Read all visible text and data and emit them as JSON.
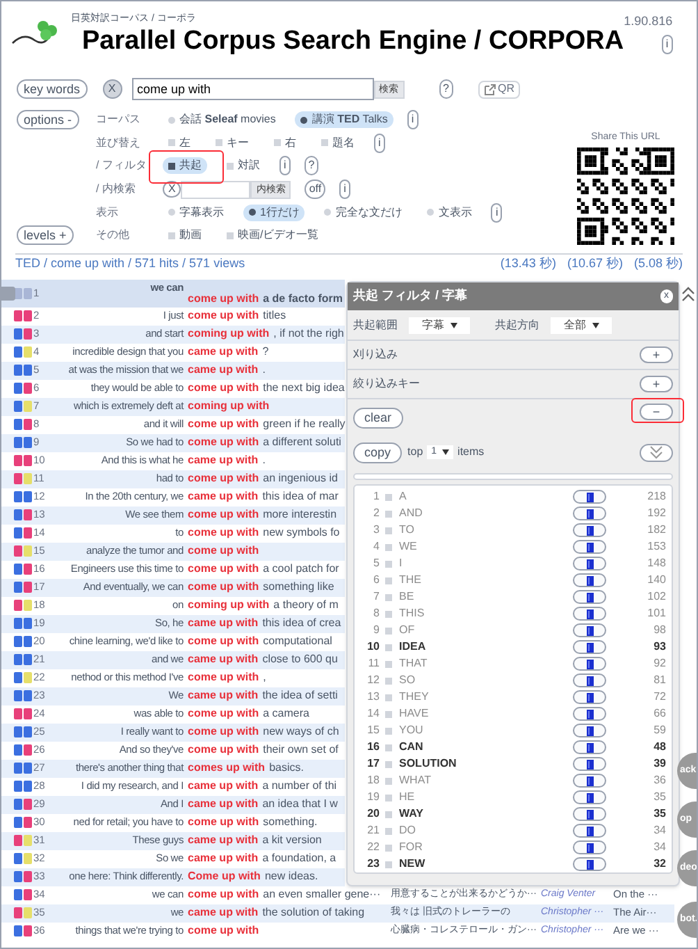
{
  "header": {
    "subtitle": "日英対訳コーパス / コーポラ",
    "title": "Parallel Corpus Search Engine / CORPORA",
    "version": "1.90.816",
    "info": "i"
  },
  "search": {
    "toggle": "key words",
    "clear": "X",
    "query": "come up with",
    "submit": "検索",
    "help": "?",
    "qr": "QR"
  },
  "options": {
    "toggle": "options -",
    "levels": "levels +",
    "share_label": "Share This URL",
    "rows": [
      {
        "label": "コーパス",
        "items": [
          {
            "kind": "radio",
            "label": "会話 **Seleaf** movies",
            "selected": false
          },
          {
            "kind": "radio",
            "label": "講演 **TED** Talks",
            "selected": true
          },
          {
            "kind": "info",
            "label": "i"
          }
        ]
      },
      {
        "label": "並び替え",
        "items": [
          {
            "kind": "checkbox",
            "label": "左",
            "checked": false
          },
          {
            "kind": "checkbox",
            "label": "キー",
            "checked": false
          },
          {
            "kind": "checkbox",
            "label": "右",
            "checked": false
          },
          {
            "kind": "checkbox",
            "label": "題名",
            "checked": false
          },
          {
            "kind": "info",
            "label": "i"
          }
        ]
      },
      {
        "label": "/ フィルタ",
        "items": [
          {
            "kind": "checkbox",
            "label": "共起",
            "checked": true,
            "highlighted": true
          },
          {
            "kind": "checkbox",
            "label": "対訳",
            "checked": false,
            "highlighted": false
          },
          {
            "kind": "info",
            "label": "i"
          },
          {
            "kind": "info",
            "label": "?"
          }
        ]
      },
      {
        "label": "/ 内検索",
        "items": [
          {
            "kind": "clear",
            "label": "X"
          },
          {
            "kind": "input"
          },
          {
            "kind": "button",
            "label": "内検索"
          },
          {
            "kind": "info",
            "label": "off"
          },
          {
            "kind": "info",
            "label": "i"
          }
        ]
      },
      {
        "label": "表示",
        "items": [
          {
            "kind": "radio",
            "label": "字幕表示",
            "selected": false
          },
          {
            "kind": "radio",
            "label": "1行だけ",
            "selected": true
          },
          {
            "kind": "radio",
            "label": "完全な文だけ",
            "selected": false
          },
          {
            "kind": "radio",
            "label": "文表示",
            "selected": false
          },
          {
            "kind": "info",
            "label": "i"
          }
        ]
      },
      {
        "label": "その他",
        "items": [
          {
            "kind": "checkbox",
            "label": "動画",
            "checked": false
          },
          {
            "kind": "checkbox",
            "label": "映画/ビデオ一覧",
            "checked": false
          }
        ]
      }
    ]
  },
  "results": {
    "breadcrumb": "TED / come up with / 571 hits / 571 views",
    "timings": [
      "(13.43 秒)",
      "(10.67 秒)",
      "(5.08 秒)"
    ],
    "rows": [
      {
        "number": "1",
        "selected": true,
        "badges": [
          {
            "color": "#a9b6d6"
          },
          {
            "color": "#a9b6d6"
          }
        ],
        "before": "we can",
        "match": "come up with",
        "after": "a de facto form"
      },
      {
        "number": "2",
        "selected": false,
        "badges": [
          {
            "color": "#e8407a"
          },
          {
            "color": "#e8407a"
          }
        ],
        "before": "I just",
        "match": "come up with",
        "after": "titles"
      },
      {
        "number": "3",
        "selected": false,
        "badges": [
          {
            "color": "#3b6fe0"
          },
          {
            "color": "#e8407a"
          }
        ],
        "before": "and start",
        "match": "coming up with",
        "after": ", if not the righ"
      },
      {
        "number": "4",
        "selected": false,
        "badges": [
          {
            "color": "#3b6fe0"
          },
          {
            "color": "#e6df6a"
          }
        ],
        "before": "incredible design that you",
        "match": "came up with",
        "after": "?"
      },
      {
        "number": "5",
        "selected": false,
        "badges": [
          {
            "color": "#3b6fe0"
          },
          {
            "color": "#3b6fe0"
          }
        ],
        "before": "at was the mission that we",
        "match": "came up with",
        "after": "."
      },
      {
        "number": "6",
        "selected": false,
        "badges": [
          {
            "color": "#3b6fe0"
          },
          {
            "color": "#e8407a"
          }
        ],
        "before": "they would be able to",
        "match": "come up with",
        "after": "the next big idea"
      },
      {
        "number": "7",
        "selected": false,
        "badges": [
          {
            "color": "#3b6fe0"
          },
          {
            "color": "#e6df6a"
          }
        ],
        "before": "which is extremely deft at",
        "match": "coming up with"
      },
      {
        "number": "8",
        "selected": false,
        "badges": [
          {
            "color": "#3b6fe0"
          },
          {
            "color": "#e8407a"
          }
        ],
        "before": "and it will",
        "match": "come up with",
        "after": "green if he really"
      },
      {
        "number": "9",
        "selected": false,
        "badges": [
          {
            "color": "#3b6fe0"
          },
          {
            "color": "#3b6fe0"
          }
        ],
        "before": "So we had to",
        "match": "come up with",
        "after": "a different soluti"
      },
      {
        "number": "10",
        "selected": false,
        "badges": [
          {
            "color": "#e8407a"
          },
          {
            "color": "#e8407a"
          }
        ],
        "before": "And this is what he",
        "match": "came up with",
        "after": "."
      },
      {
        "number": "11",
        "selected": false,
        "badges": [
          {
            "color": "#e8407a"
          },
          {
            "color": "#e6df6a"
          }
        ],
        "before": "had to",
        "match": "come up with",
        "after": "an ingenious id"
      },
      {
        "number": "12",
        "selected": false,
        "badges": [
          {
            "color": "#3b6fe0"
          },
          {
            "color": "#3b6fe0"
          }
        ],
        "before": "In the 20th century, we",
        "match": "came up with",
        "after": "this idea of mar"
      },
      {
        "number": "13",
        "selected": false,
        "badges": [
          {
            "color": "#3b6fe0"
          },
          {
            "color": "#e8407a"
          }
        ],
        "before": "We see them",
        "match": "come up with",
        "after": "more interestin"
      },
      {
        "number": "14",
        "selected": false,
        "badges": [
          {
            "color": "#3b6fe0"
          },
          {
            "color": "#e8407a"
          }
        ],
        "before": "to",
        "match": "come up with",
        "after": "new symbols fo"
      },
      {
        "number": "15",
        "selected": false,
        "badges": [
          {
            "color": "#e8407a"
          },
          {
            "color": "#e6df6a"
          }
        ],
        "before": "analyze the tumor and",
        "match": "come up with"
      },
      {
        "number": "16",
        "selected": false,
        "badges": [
          {
            "color": "#3b6fe0"
          },
          {
            "color": "#e8407a"
          }
        ],
        "before": "Engineers use this time to",
        "match": "come up with",
        "after": "a cool patch for"
      },
      {
        "number": "17",
        "selected": false,
        "badges": [
          {
            "color": "#3b6fe0"
          },
          {
            "color": "#e8407a"
          }
        ],
        "before": "And eventually, we can",
        "match": "come up with",
        "after": "something like"
      },
      {
        "number": "18",
        "selected": false,
        "badges": [
          {
            "color": "#e8407a"
          },
          {
            "color": "#e6df6a"
          }
        ],
        "before": "on",
        "match": "coming up with",
        "after": "a theory of m"
      },
      {
        "number": "19",
        "selected": false,
        "badges": [
          {
            "color": "#3b6fe0"
          },
          {
            "color": "#3b6fe0"
          }
        ],
        "before": "So, he",
        "match": "came up with",
        "after": "this idea of crea"
      },
      {
        "number": "20",
        "selected": false,
        "badges": [
          {
            "color": "#3b6fe0"
          },
          {
            "color": "#3b6fe0"
          }
        ],
        "before": "chine learning, we'd like to",
        "match": "come up with",
        "after": "computational"
      },
      {
        "number": "21",
        "selected": false,
        "badges": [
          {
            "color": "#3b6fe0"
          },
          {
            "color": "#3b6fe0"
          }
        ],
        "before": "and we",
        "match": "came up with",
        "after": "close to 600 qu"
      },
      {
        "number": "22",
        "selected": false,
        "badges": [
          {
            "color": "#3b6fe0"
          },
          {
            "color": "#e6df6a"
          }
        ],
        "before": "nethod or this method I've",
        "match": "come up with",
        "after": ","
      },
      {
        "number": "23",
        "selected": false,
        "badges": [
          {
            "color": "#3b6fe0"
          },
          {
            "color": "#3b6fe0"
          }
        ],
        "before": "We",
        "match": "came up with",
        "after": "the idea of setti"
      },
      {
        "number": "24",
        "selected": false,
        "badges": [
          {
            "color": "#e8407a"
          },
          {
            "color": "#e8407a"
          }
        ],
        "before": "was able to",
        "match": "come up with",
        "after": "a camera"
      },
      {
        "number": "25",
        "selected": false,
        "badges": [
          {
            "color": "#3b6fe0"
          },
          {
            "color": "#3b6fe0"
          }
        ],
        "before": "I really want to",
        "match": "come up with",
        "after": "new ways of ch"
      },
      {
        "number": "26",
        "selected": false,
        "badges": [
          {
            "color": "#3b6fe0"
          },
          {
            "color": "#e8407a"
          }
        ],
        "before": "And so they've",
        "match": "come up with",
        "after": "their own set of"
      },
      {
        "number": "27",
        "selected": false,
        "badges": [
          {
            "color": "#3b6fe0"
          },
          {
            "color": "#3b6fe0"
          }
        ],
        "before": "there's another thing that",
        "match": "comes up with",
        "after": "basics."
      },
      {
        "number": "28",
        "selected": false,
        "badges": [
          {
            "color": "#3b6fe0"
          },
          {
            "color": "#3b6fe0"
          }
        ],
        "before": "I did my research, and I",
        "match": "came up with",
        "after": "a number of thi"
      },
      {
        "number": "29",
        "selected": false,
        "badges": [
          {
            "color": "#3b6fe0"
          },
          {
            "color": "#e8407a"
          }
        ],
        "before": "And I",
        "match": "came up with",
        "after": "an idea that I w"
      },
      {
        "number": "30",
        "selected": false,
        "badges": [
          {
            "color": "#3b6fe0"
          },
          {
            "color": "#e8407a"
          }
        ],
        "before": "ned for retail; you have to",
        "match": "come up with",
        "after": "something."
      },
      {
        "number": "31",
        "selected": false,
        "badges": [
          {
            "color": "#e8407a"
          },
          {
            "color": "#e6df6a"
          }
        ],
        "before": "These guys",
        "match": "came up with",
        "after": "a kit version"
      },
      {
        "number": "32",
        "selected": false,
        "badges": [
          {
            "color": "#3b6fe0"
          },
          {
            "color": "#e6df6a"
          }
        ],
        "before": "So we",
        "match": "came up with",
        "after": "a foundation, a"
      },
      {
        "number": "33",
        "selected": false,
        "badges": [
          {
            "color": "#3b6fe0"
          },
          {
            "color": "#e8407a"
          }
        ],
        "before": "one here: Think differently.",
        "match": "Come up with",
        "after": "new ideas."
      },
      {
        "number": "34",
        "selected": false,
        "badges": [
          {
            "color": "#3b6fe0"
          },
          {
            "color": "#e8407a"
          }
        ],
        "before": "we can",
        "match": "come up with",
        "after": "an even smaller gene···",
        "translation": "用意することが出来るかどうか···",
        "speaker": "Craig Venter",
        "talk": "On the ···"
      },
      {
        "number": "35",
        "selected": false,
        "badges": [
          {
            "color": "#e8407a"
          },
          {
            "color": "#e6df6a"
          }
        ],
        "before": "we",
        "match": "came up with",
        "after": "the solution of taking",
        "translation": "我々は 旧式のトレーラーの",
        "speaker": "Christopher ···",
        "talk": "The Air···"
      },
      {
        "number": "36",
        "selected": false,
        "badges": [
          {
            "color": "#3b6fe0"
          },
          {
            "color": "#e8407a"
          }
        ],
        "before": "things that we're trying to",
        "match": "come up with",
        "translation": "心臓病・コレステロール・ガン···",
        "speaker": "Christopher ···",
        "talk": "Are we ···"
      }
    ]
  },
  "filter_panel": {
    "title": "共起 フィルタ / 字幕",
    "close": "x",
    "range_label": "共起範囲",
    "range_value": "字幕",
    "direction_label": "共起方向",
    "direction_value": "全部",
    "sections": [
      {
        "label": "刈り込み",
        "button": "+"
      },
      {
        "label": "絞り込みキー",
        "button": "+"
      }
    ],
    "clear": "clear",
    "collapse": {
      "label": "−",
      "highlighted": true
    },
    "copy": "copy",
    "top_label": "top",
    "top_value": "1",
    "items_label": "items",
    "words": [
      {
        "rank": "1",
        "word": "A",
        "count": "218",
        "active": false
      },
      {
        "rank": "2",
        "word": "AND",
        "count": "192",
        "active": false
      },
      {
        "rank": "3",
        "word": "TO",
        "count": "182",
        "active": false
      },
      {
        "rank": "4",
        "word": "WE",
        "count": "153",
        "active": false
      },
      {
        "rank": "5",
        "word": "I",
        "count": "148",
        "active": false
      },
      {
        "rank": "6",
        "word": "THE",
        "count": "140",
        "active": false
      },
      {
        "rank": "7",
        "word": "BE",
        "count": "102",
        "active": false
      },
      {
        "rank": "8",
        "word": "THIS",
        "count": "101",
        "active": false
      },
      {
        "rank": "9",
        "word": "OF",
        "count": "98",
        "active": false
      },
      {
        "rank": "10",
        "word": "IDEA",
        "count": "93",
        "active": true
      },
      {
        "rank": "11",
        "word": "THAT",
        "count": "92",
        "active": false
      },
      {
        "rank": "12",
        "word": "SO",
        "count": "81",
        "active": false
      },
      {
        "rank": "13",
        "word": "THEY",
        "count": "72",
        "active": false
      },
      {
        "rank": "14",
        "word": "HAVE",
        "count": "66",
        "active": false
      },
      {
        "rank": "15",
        "word": "YOU",
        "count": "59",
        "active": false
      },
      {
        "rank": "16",
        "word": "CAN",
        "count": "48",
        "active": true
      },
      {
        "rank": "17",
        "word": "SOLUTION",
        "count": "39",
        "active": true
      },
      {
        "rank": "18",
        "word": "WHAT",
        "count": "36",
        "active": false
      },
      {
        "rank": "19",
        "word": "HE",
        "count": "35",
        "active": false
      },
      {
        "rank": "20",
        "word": "WAY",
        "count": "35",
        "active": true
      },
      {
        "rank": "21",
        "word": "DO",
        "count": "34",
        "active": false
      },
      {
        "rank": "22",
        "word": "FOR",
        "count": "34",
        "active": false
      },
      {
        "rank": "23",
        "word": "NEW",
        "count": "32",
        "active": true
      }
    ]
  },
  "side_buttons": [
    "ack",
    "op",
    "deo",
    "bot."
  ]
}
